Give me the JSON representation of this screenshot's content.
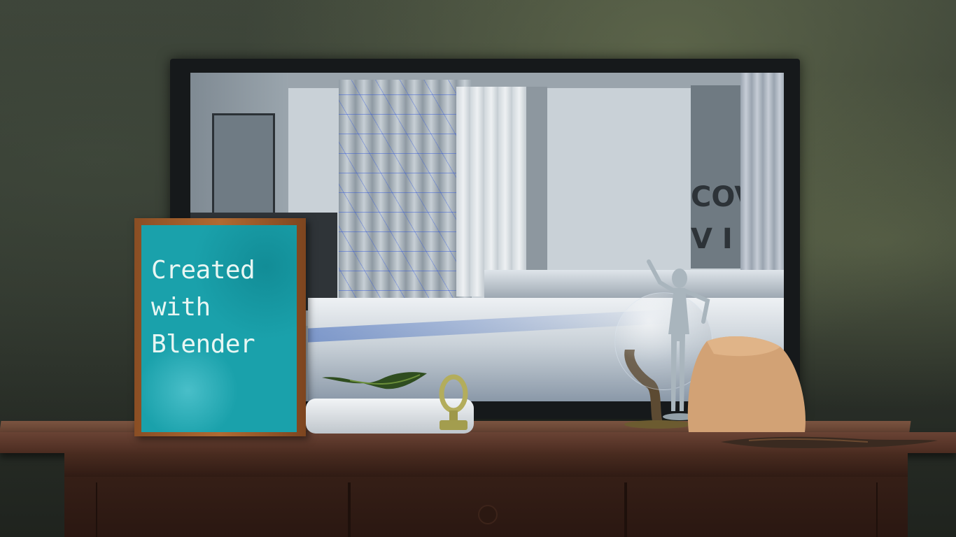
{
  "scene": {
    "frame_text": "Created\nwith\nBlender",
    "tv_screen_partial_text": "COV\nV I"
  }
}
